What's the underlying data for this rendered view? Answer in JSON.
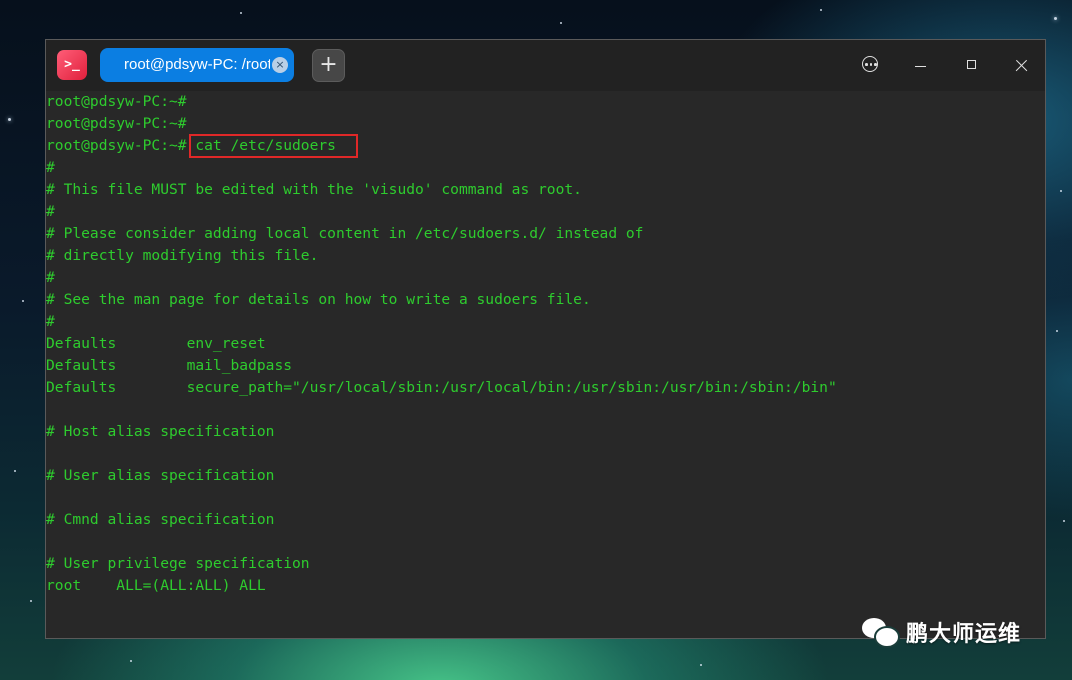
{
  "titlebar": {
    "app_icon_glyph": ">_",
    "tab_label": "root@pdsyw-PC: /root",
    "tab_close_glyph": "×",
    "new_tab_glyph": "+"
  },
  "terminal": {
    "lines": [
      "root@pdsyw-PC:~#",
      "root@pdsyw-PC:~#",
      "root@pdsyw-PC:~# cat /etc/sudoers",
      "#",
      "# This file MUST be edited with the 'visudo' command as root.",
      "#",
      "# Please consider adding local content in /etc/sudoers.d/ instead of",
      "# directly modifying this file.",
      "#",
      "# See the man page for details on how to write a sudoers file.",
      "#",
      "Defaults        env_reset",
      "Defaults        mail_badpass",
      "Defaults        secure_path=\"/usr/local/sbin:/usr/local/bin:/usr/sbin:/usr/bin:/sbin:/bin\"",
      "",
      "# Host alias specification",
      "",
      "# User alias specification",
      "",
      "# Cmnd alias specification",
      "",
      "# User privilege specification",
      "root    ALL=(ALL:ALL) ALL"
    ],
    "text_color": "#2ecc2e",
    "highlight_color": "#e02828"
  },
  "watermark": {
    "text": "鹏大师运维"
  },
  "colors": {
    "tab_active": "#0b7ee2",
    "app_icon": "#e0203c",
    "window_bg": "#282828"
  }
}
